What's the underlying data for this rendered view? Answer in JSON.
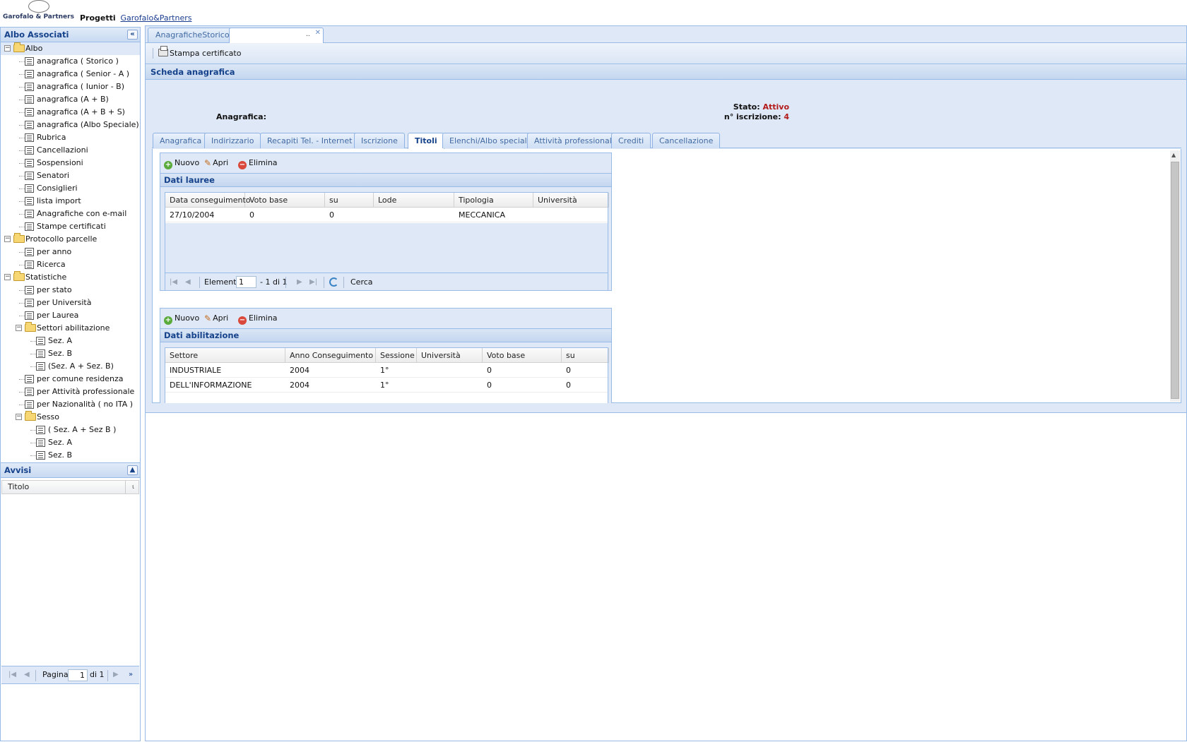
{
  "header": {
    "logo_text": "Garofalo & Partners",
    "app_title": "Progetti",
    "app_link": "Garofalo&Partners"
  },
  "west": {
    "title": "Albo Associati",
    "collapse_icon": "double-chevron-left-icon",
    "tree": [
      {
        "label": "Albo",
        "type": "folder",
        "level": 0
      },
      {
        "label": "anagrafica ( Storico )",
        "type": "leaf",
        "level": 1
      },
      {
        "label": "anagrafica ( Senior - A )",
        "type": "leaf",
        "level": 1
      },
      {
        "label": "anagrafica ( Iunior - B)",
        "type": "leaf",
        "level": 1
      },
      {
        "label": "anagrafica (A + B)",
        "type": "leaf",
        "level": 1
      },
      {
        "label": "anagrafica (A + B + S)",
        "type": "leaf",
        "level": 1
      },
      {
        "label": "anagrafica (Albo Speciale)",
        "type": "leaf",
        "level": 1
      },
      {
        "label": "Rubrica",
        "type": "leaf",
        "level": 1
      },
      {
        "label": "Cancellazioni",
        "type": "leaf",
        "level": 1
      },
      {
        "label": "Sospensioni",
        "type": "leaf",
        "level": 1
      },
      {
        "label": "Senatori",
        "type": "leaf",
        "level": 1
      },
      {
        "label": "Consiglieri",
        "type": "leaf",
        "level": 1
      },
      {
        "label": "lista import",
        "type": "leaf",
        "level": 1
      },
      {
        "label": "Anagrafiche con e-mail",
        "type": "leaf",
        "level": 1
      },
      {
        "label": "Stampe certificati",
        "type": "leaf",
        "level": 1
      },
      {
        "label": "Protocollo parcelle",
        "type": "folder",
        "level": 0
      },
      {
        "label": "per anno",
        "type": "leaf",
        "level": 1
      },
      {
        "label": "Ricerca",
        "type": "leaf",
        "level": 1
      },
      {
        "label": "Statistiche",
        "type": "folder",
        "level": 0
      },
      {
        "label": "per stato",
        "type": "leaf",
        "level": 1
      },
      {
        "label": "per Università",
        "type": "leaf",
        "level": 1
      },
      {
        "label": "per Laurea",
        "type": "leaf",
        "level": 1
      },
      {
        "label": "Settori abilitazione",
        "type": "folder",
        "level": 1
      },
      {
        "label": "Sez. A",
        "type": "leaf",
        "level": 2
      },
      {
        "label": "Sez. B",
        "type": "leaf",
        "level": 2
      },
      {
        "label": "(Sez. A + Sez. B)",
        "type": "leaf",
        "level": 2
      },
      {
        "label": "per comune residenza",
        "type": "leaf",
        "level": 1
      },
      {
        "label": "per Attività professionale",
        "type": "leaf",
        "level": 1
      },
      {
        "label": "per Nazionalità ( no ITA )",
        "type": "leaf",
        "level": 1
      },
      {
        "label": "Sesso",
        "type": "folder",
        "level": 1
      },
      {
        "label": "( Sez. A + Sez B )",
        "type": "leaf",
        "level": 2
      },
      {
        "label": "Sez. A",
        "type": "leaf",
        "level": 2
      },
      {
        "label": "Sez. B",
        "type": "leaf",
        "level": 2
      }
    ],
    "avvisi": {
      "title": "Avvisi",
      "column": "Titolo",
      "column2": "ι",
      "pager": {
        "label": "Pagina",
        "page": "1",
        "of": "di 1"
      }
    }
  },
  "center": {
    "tabs": [
      {
        "label": "AnagraficheStorico",
        "active": false
      },
      {
        "label": "",
        "active": true
      }
    ],
    "toolbar": {
      "print_label": "Stampa certificato"
    },
    "scheda_title": "Scheda anagrafica",
    "anagrafica_label": "Anagrafica:",
    "stato_label": "Stato:",
    "stato_value": "Attivo",
    "iscrizione_label": "n° iscrizione:",
    "iscrizione_value": "4",
    "subtabs": [
      "Anagrafica",
      "Indirizzario",
      "Recapiti Tel. - Internet",
      "Iscrizione",
      "Titoli",
      "Elenchi/Albo speciali",
      "Attività professionali",
      "Crediti",
      "Cancellazione"
    ],
    "active_subtab": "Titoli",
    "btn_nuovo": "Nuovo",
    "btn_apri": "Apri",
    "btn_elimina": "Elimina",
    "lauree": {
      "title": "Dati lauree",
      "columns": [
        "Data conseguimento",
        "Voto base",
        "su",
        "Lode",
        "Tipologia",
        "Università"
      ],
      "rows": [
        [
          "27/10/2004",
          "0",
          "0",
          "",
          "MECCANICA",
          ""
        ]
      ],
      "pager": {
        "label": "Elemento",
        "value": "1",
        "of": "- 1 di 1",
        "search": "Cerca"
      }
    },
    "abilitazione": {
      "title": "Dati abilitazione",
      "columns": [
        "Settore",
        "Anno Conseguimento",
        "Sessione",
        "Università",
        "Voto base",
        "su"
      ],
      "rows": [
        [
          "INDUSTRIALE",
          "2004",
          "1°",
          "",
          "0",
          "0"
        ],
        [
          "DELL'INFORMAZIONE",
          "2004",
          "1°",
          "",
          "0",
          "0"
        ]
      ]
    }
  }
}
